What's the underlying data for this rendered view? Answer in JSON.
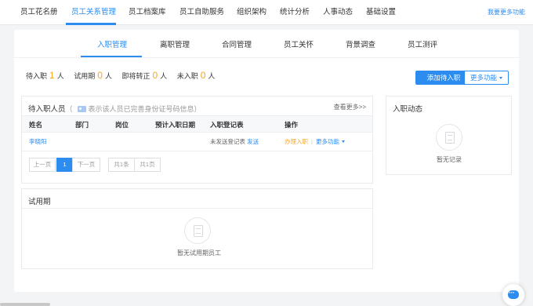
{
  "topnav": {
    "items": [
      "员工花名册",
      "员工关系管理",
      "员工档案库",
      "员工自助服务",
      "组织架构",
      "统计分析",
      "人事动态",
      "基础设置"
    ],
    "active_index": 1,
    "more_link": "我要更多功能"
  },
  "subtabs": {
    "items": [
      "入职管理",
      "离职管理",
      "合同管理",
      "员工关怀",
      "背景调查",
      "员工测评"
    ],
    "active_index": 0
  },
  "stats": [
    {
      "label": "待入职",
      "value": "1",
      "unit": "人"
    },
    {
      "label": "试用期",
      "value": "0",
      "unit": "人"
    },
    {
      "label": "即将转正",
      "value": "0",
      "unit": "人"
    },
    {
      "label": "未入职",
      "value": "0",
      "unit": "人"
    }
  ],
  "actions": {
    "add_label": "添加待入职",
    "more_label": "更多功能"
  },
  "pending_panel": {
    "title": "待入职人员",
    "hint_paren_open": "（",
    "hint": "表示该人员已完善身份证号码信息",
    "hint_paren_close": "）",
    "view_more": "查看更多>>",
    "columns": [
      "姓名",
      "部门",
      "岗位",
      "预计入职日期",
      "入职登记表",
      "操作"
    ],
    "rows": [
      {
        "name": "李晓阳",
        "department": "",
        "position": "",
        "expected_date": "",
        "reg_status": "未发送登记表",
        "reg_send": "发送",
        "op_onboard": "办理入职",
        "op_sep": "|",
        "op_more": "更多功能"
      }
    ],
    "pager": {
      "prev": "上一页",
      "current": "1",
      "next": "下一页",
      "total": "共1条",
      "pages": "共1页"
    }
  },
  "onboard_panel": {
    "title": "入职动态",
    "empty": "暂无记录"
  },
  "probation_panel": {
    "title": "试用期",
    "empty": "暂无试用期员工"
  },
  "colors": {
    "accent": "#2d8cf0",
    "highlight": "#f5a623"
  }
}
